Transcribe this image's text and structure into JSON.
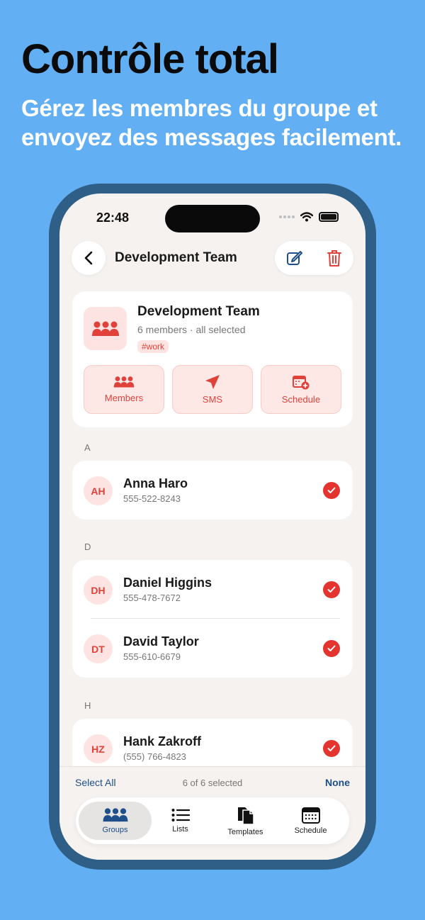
{
  "promo": {
    "title": "Contrôle total",
    "subtitle": "Gérez les membres du groupe et envoyez des messages facilement."
  },
  "status_bar": {
    "time": "22:48"
  },
  "nav": {
    "title": "Development Team"
  },
  "group": {
    "name": "Development Team",
    "meta": "6 members · all selected",
    "tag": "#work",
    "actions": [
      {
        "label": "Members",
        "icon": "members-icon"
      },
      {
        "label": "SMS",
        "icon": "send-icon"
      },
      {
        "label": "Schedule",
        "icon": "calendar-add-icon"
      }
    ]
  },
  "sections": [
    {
      "letter": "A",
      "contacts": [
        {
          "initials": "AH",
          "name": "Anna Haro",
          "phone": "555-522-8243",
          "selected": true
        }
      ]
    },
    {
      "letter": "D",
      "contacts": [
        {
          "initials": "DH",
          "name": "Daniel Higgins",
          "phone": "555-478-7672",
          "selected": true
        },
        {
          "initials": "DT",
          "name": "David Taylor",
          "phone": "555-610-6679",
          "selected": true
        }
      ]
    },
    {
      "letter": "H",
      "contacts": [
        {
          "initials": "HZ",
          "name": "Hank Zakroff",
          "phone": "(555) 766-4823",
          "selected": true
        }
      ]
    }
  ],
  "selection": {
    "select_all": "Select All",
    "count": "6 of 6 selected",
    "none": "None"
  },
  "tabs": [
    {
      "label": "Groups",
      "icon": "groups-icon",
      "active": true
    },
    {
      "label": "Lists",
      "icon": "list-icon",
      "active": false
    },
    {
      "label": "Templates",
      "icon": "templates-icon",
      "active": false
    },
    {
      "label": "Schedule",
      "icon": "calendar-icon",
      "active": false
    }
  ],
  "colors": {
    "background": "#62b0f3",
    "accent": "#e0413a",
    "link": "#1f4f8a",
    "frame": "#2f5f86"
  }
}
